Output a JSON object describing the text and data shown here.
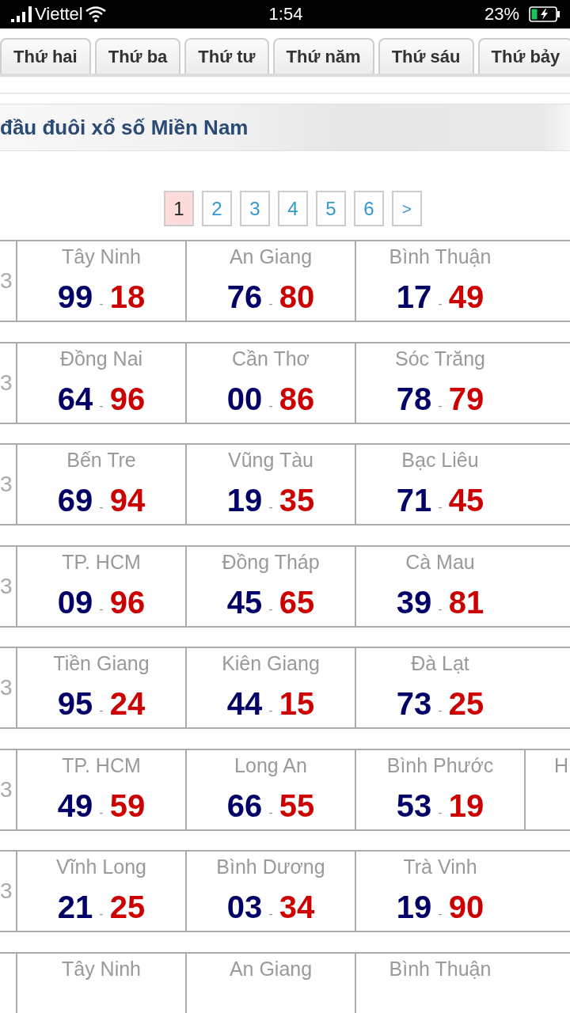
{
  "status_bar": {
    "carrier": "Viettel",
    "time": "1:54",
    "battery": "23%"
  },
  "tabs": [
    {
      "label": "Thứ hai",
      "selected": false
    },
    {
      "label": "Thứ ba",
      "selected": false
    },
    {
      "label": "Thứ tư",
      "selected": false
    },
    {
      "label": "Thứ năm",
      "selected": false
    },
    {
      "label": "Thứ sáu",
      "selected": false
    },
    {
      "label": "Thứ bảy",
      "selected": false
    }
  ],
  "section_title": "đầu đuôi xổ số Miền Nam",
  "pagination": [
    {
      "kind": "page",
      "label": "1",
      "selected": true
    },
    {
      "kind": "page",
      "label": "2",
      "selected": false
    },
    {
      "kind": "page",
      "label": "3",
      "selected": false
    },
    {
      "kind": "page",
      "label": "4",
      "selected": false
    },
    {
      "kind": "page",
      "label": "5",
      "selected": false
    },
    {
      "kind": "page",
      "label": "6",
      "selected": false
    },
    {
      "kind": "next",
      "label": ">",
      "selected": false
    }
  ],
  "results": [
    {
      "date": "3",
      "cells": [
        {
          "name": "Tây Ninh",
          "head": "99",
          "dash": "-",
          "tail": "18"
        },
        {
          "name": "An Giang",
          "head": "76",
          "dash": "-",
          "tail": "80"
        },
        {
          "name": "Bình Thuận",
          "head": "17",
          "dash": "-",
          "tail": "49"
        }
      ]
    },
    {
      "date": "3",
      "cells": [
        {
          "name": "Đồng Nai",
          "head": "64",
          "dash": "-",
          "tail": "96"
        },
        {
          "name": "Cần Thơ",
          "head": "00",
          "dash": "-",
          "tail": "86"
        },
        {
          "name": "Sóc Trăng",
          "head": "78",
          "dash": "-",
          "tail": "79"
        }
      ]
    },
    {
      "date": "3",
      "cells": [
        {
          "name": "Bến Tre",
          "head": "69",
          "dash": "-",
          "tail": "94"
        },
        {
          "name": "Vũng Tàu",
          "head": "19",
          "dash": "-",
          "tail": "35"
        },
        {
          "name": "Bạc Liêu",
          "head": "71",
          "dash": "-",
          "tail": "45"
        }
      ]
    },
    {
      "date": "3",
      "cells": [
        {
          "name": "TP. HCM",
          "head": "09",
          "dash": "-",
          "tail": "96"
        },
        {
          "name": "Đồng Tháp",
          "head": "45",
          "dash": "-",
          "tail": "65"
        },
        {
          "name": "Cà Mau",
          "head": "39",
          "dash": "-",
          "tail": "81"
        }
      ]
    },
    {
      "date": "3",
      "cells": [
        {
          "name": "Tiền Giang",
          "head": "95",
          "dash": "-",
          "tail": "24"
        },
        {
          "name": "Kiên Giang",
          "head": "44",
          "dash": "-",
          "tail": "15"
        },
        {
          "name": "Đà Lạt",
          "head": "73",
          "dash": "-",
          "tail": "25"
        }
      ]
    },
    {
      "date": "3",
      "cells": [
        {
          "name": "TP. HCM",
          "head": "49",
          "dash": "-",
          "tail": "59"
        },
        {
          "name": "Long An",
          "head": "66",
          "dash": "-",
          "tail": "55"
        },
        {
          "name": "Bình Phước",
          "head": "53",
          "dash": "-",
          "tail": "19"
        },
        {
          "name": "H"
        }
      ]
    },
    {
      "date": "3",
      "cells": [
        {
          "name": "Vĩnh Long",
          "head": "21",
          "dash": "-",
          "tail": "25"
        },
        {
          "name": "Bình Dương",
          "head": "03",
          "dash": "-",
          "tail": "34"
        },
        {
          "name": "Trà Vinh",
          "head": "19",
          "dash": "-",
          "tail": "90"
        }
      ]
    },
    {
      "cells": [
        {
          "name": "Tây Ninh"
        },
        {
          "name": "An Giang"
        },
        {
          "name": "Bình Thuận"
        }
      ]
    }
  ]
}
